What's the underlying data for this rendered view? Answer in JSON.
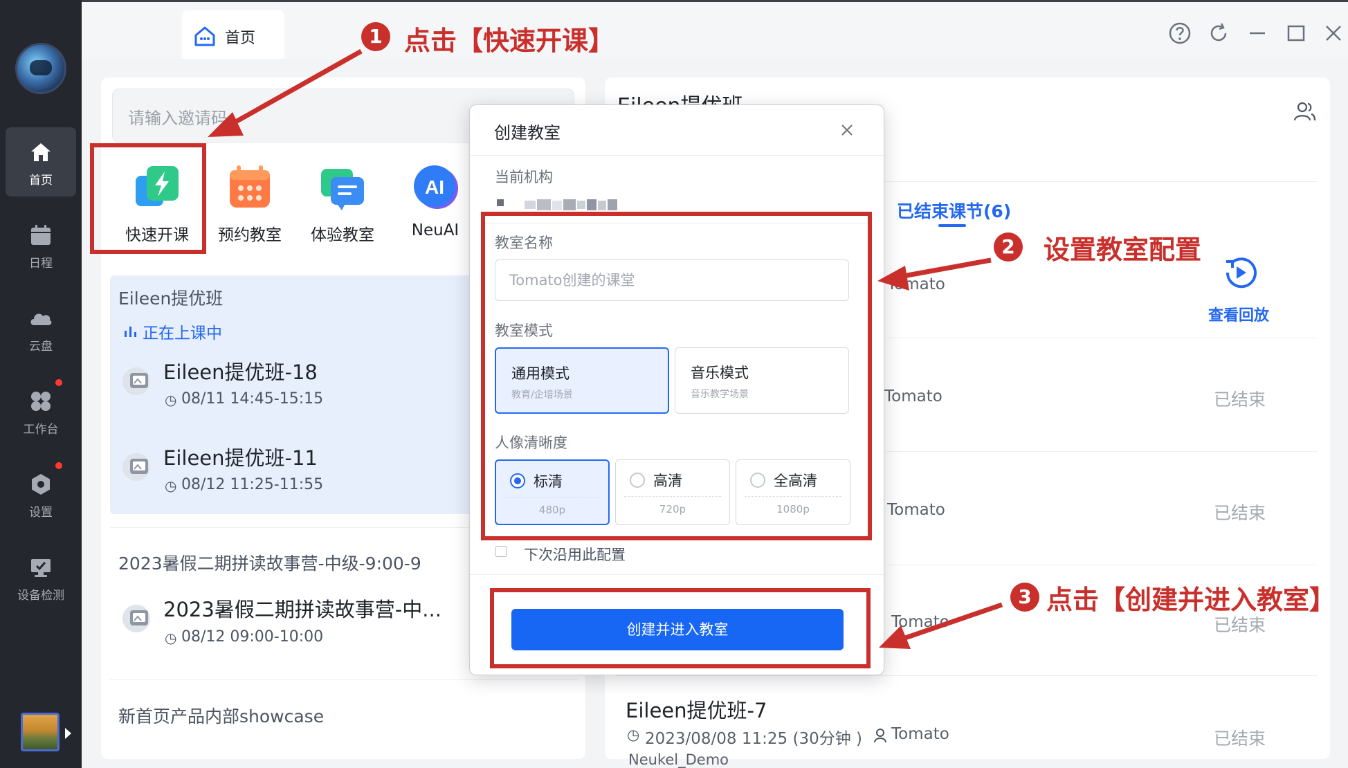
{
  "sidebar": {
    "items": [
      {
        "label": "首页",
        "icon": "home-icon",
        "active": true
      },
      {
        "label": "日程",
        "icon": "calendar-icon"
      },
      {
        "label": "云盘",
        "icon": "cloud-icon"
      },
      {
        "label": "工作台",
        "icon": "workbench-icon",
        "badge": true
      },
      {
        "label": "设置",
        "icon": "gear-icon",
        "badge": true
      },
      {
        "label": "设备检测",
        "icon": "device-check-icon"
      }
    ]
  },
  "tab": {
    "label": "首页"
  },
  "search": {
    "placeholder": "请输入邀请码"
  },
  "shortcuts": [
    {
      "label": "快速开课",
      "icon": "quick-start-icon"
    },
    {
      "label": "预约教室",
      "icon": "schedule-classroom-icon"
    },
    {
      "label": "体验教室",
      "icon": "trial-classroom-icon"
    },
    {
      "label": "NeuAI",
      "icon": "neuai-icon"
    }
  ],
  "classes": {
    "card1": {
      "title": "Eileen提优班",
      "status": "正在上课中",
      "sessions": [
        {
          "name": "Eileen提优班-18",
          "time": "08/11 14:45-15:15"
        },
        {
          "name": "Eileen提优班-11",
          "time": "08/12 11:25-11:55"
        }
      ]
    },
    "card2": {
      "title": "2023暑假二期拼读故事营-中级-9:00-9",
      "session": {
        "name": "2023暑假二期拼读故事营-中...",
        "time": "08/12 09:00-10:00"
      }
    },
    "card3": {
      "title": "新首页产品内部showcase"
    }
  },
  "right": {
    "title": "Eileen提优班",
    "tab": "已结束课节(6)",
    "replay": "查看回放",
    "rows": [
      {
        "teacher": "Tomato"
      },
      {
        "teacher": "Tomato",
        "status": "已结束"
      },
      {
        "teacher": "Tomato",
        "status": "已结束"
      },
      {
        "teacher": "Tomato",
        "status": "已结束"
      }
    ],
    "last": {
      "name": "Eileen提优班-7",
      "time": "2023/08/08 11:25 (30分钟 )",
      "teacher": "Tomato",
      "status": "已结束",
      "extra": "Neukel_Demo"
    }
  },
  "dialog": {
    "title": "创建教室",
    "org_label": "当前机构",
    "name_label": "教室名称",
    "name_placeholder": "Tomato创建的课堂",
    "mode_label": "教室模式",
    "modes": [
      {
        "name": "通用模式",
        "desc": "教育/企培场景",
        "selected": true
      },
      {
        "name": "音乐模式",
        "desc": "音乐教学场景",
        "selected": false
      }
    ],
    "res_label": "人像清晰度",
    "resolutions": [
      {
        "name": "标清",
        "px": "480p",
        "selected": true
      },
      {
        "name": "高清",
        "px": "720p",
        "selected": false
      },
      {
        "name": "全高清",
        "px": "1080p",
        "selected": false
      }
    ],
    "remember": "下次沿用此配置",
    "submit": "创建并进入教室"
  },
  "annotations": [
    {
      "num": "1",
      "text": "点击【快速开课】"
    },
    {
      "num": "2",
      "text": "设置教室配置"
    },
    {
      "num": "3",
      "text": "点击【创建并进入教室】"
    }
  ],
  "colors": {
    "accent": "#2468f2",
    "annotation": "#c9302c",
    "sidebar": "#24272d"
  }
}
